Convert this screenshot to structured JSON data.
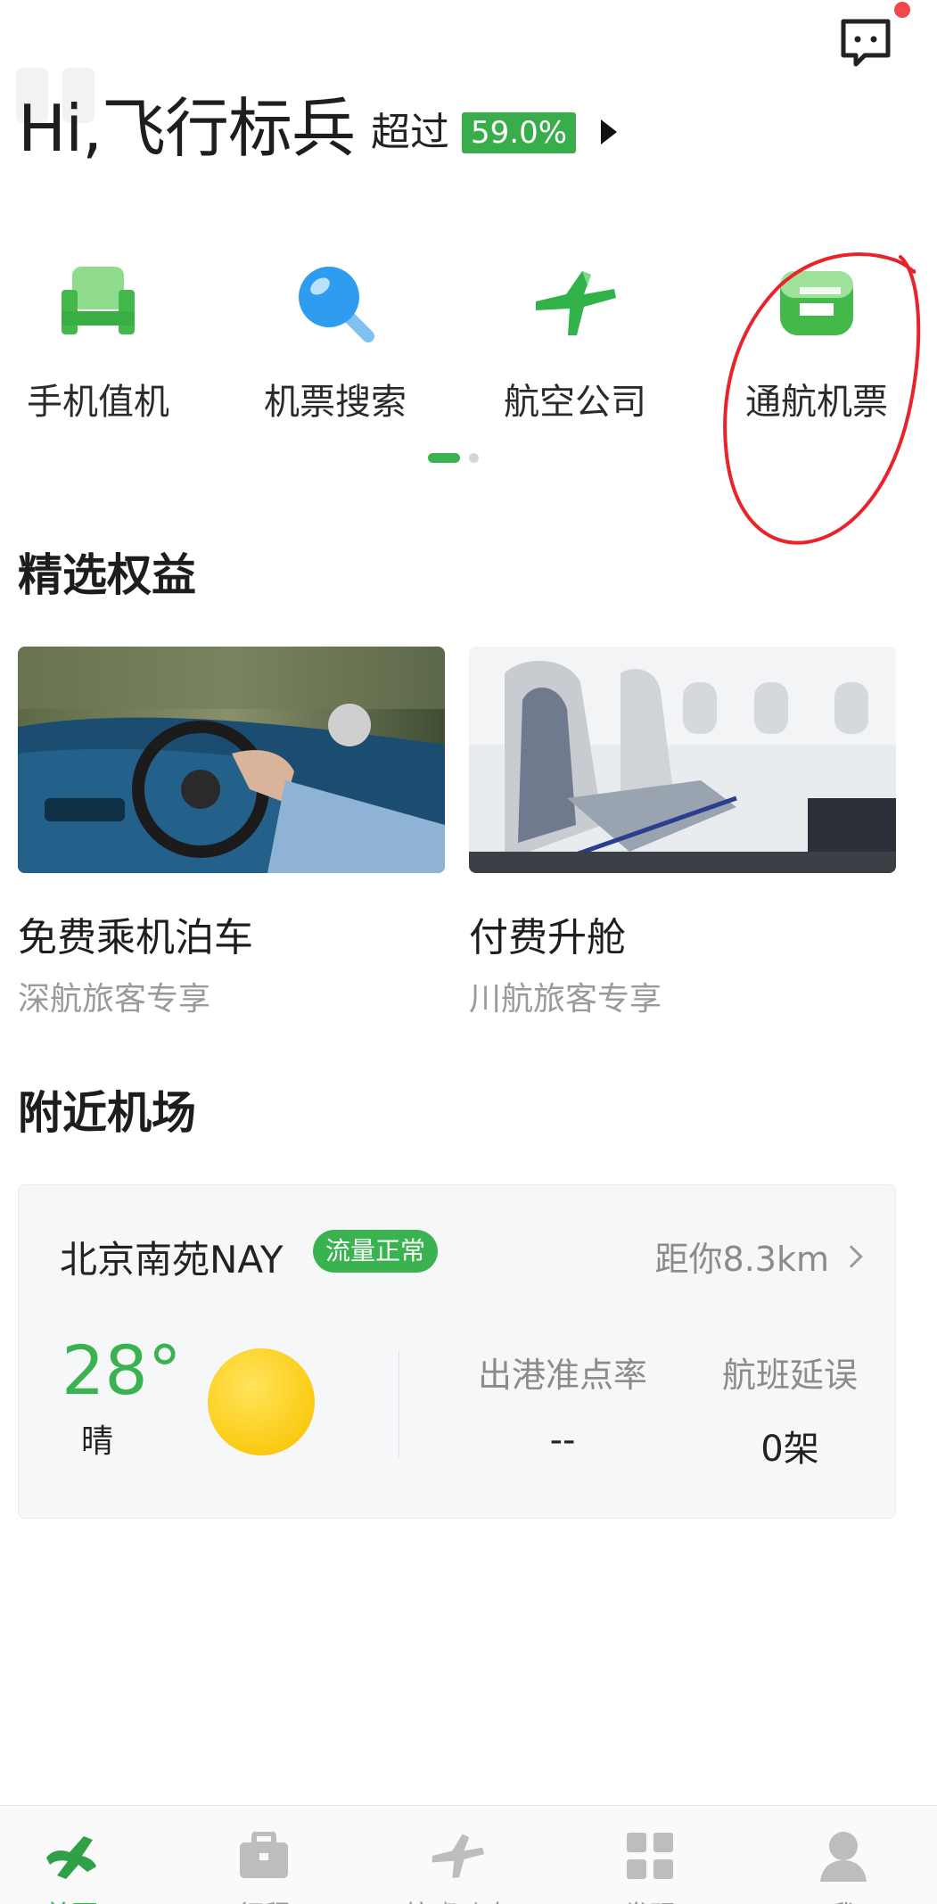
{
  "header": {
    "greeting": "Hi,飞行标兵",
    "exceed_label": "超过",
    "exceed_percent": "59.0%",
    "message_icon": "message-icon",
    "has_unread": true
  },
  "quick_entries": [
    {
      "label": "手机值机",
      "icon": "seat-icon"
    },
    {
      "label": "机票搜索",
      "icon": "search-icon"
    },
    {
      "label": "航空公司",
      "icon": "plane-icon"
    },
    {
      "label": "通航机票",
      "icon": "general-aviation-icon"
    }
  ],
  "quick_pager": {
    "pages": 2,
    "current": 1
  },
  "benefits_section": {
    "title": "精选权益",
    "cards": [
      {
        "title": "免费乘机泊车",
        "subtitle": "深航旅客专享",
        "image": "car-steering-photo"
      },
      {
        "title": "付费升舱",
        "subtitle": "川航旅客专享",
        "image": "cabin-seat-photo"
      }
    ]
  },
  "nearby_section": {
    "title": "附近机场",
    "airport": {
      "name": "北京南苑NAY",
      "status_badge": "流量正常",
      "distance": "距你8.3km",
      "temperature": "28°",
      "weather": "晴",
      "weather_icon": "sun-icon",
      "stats": [
        {
          "label": "出港准点率",
          "value": "--"
        },
        {
          "label": "航班延误",
          "value": "0架"
        }
      ]
    }
  },
  "tabbar": [
    {
      "label": "首页",
      "icon": "home-icon",
      "active": true
    },
    {
      "label": "行程",
      "icon": "briefcase-icon",
      "active": false
    },
    {
      "label": "航班动态",
      "icon": "flight-status-icon",
      "active": false
    },
    {
      "label": "发现",
      "icon": "grid-icon",
      "active": false
    },
    {
      "label": "我",
      "icon": "user-icon",
      "active": false
    }
  ],
  "colors": {
    "accent_green": "#3ab24f",
    "badge_red": "#f0484b",
    "annotation_red": "#e8232a"
  }
}
